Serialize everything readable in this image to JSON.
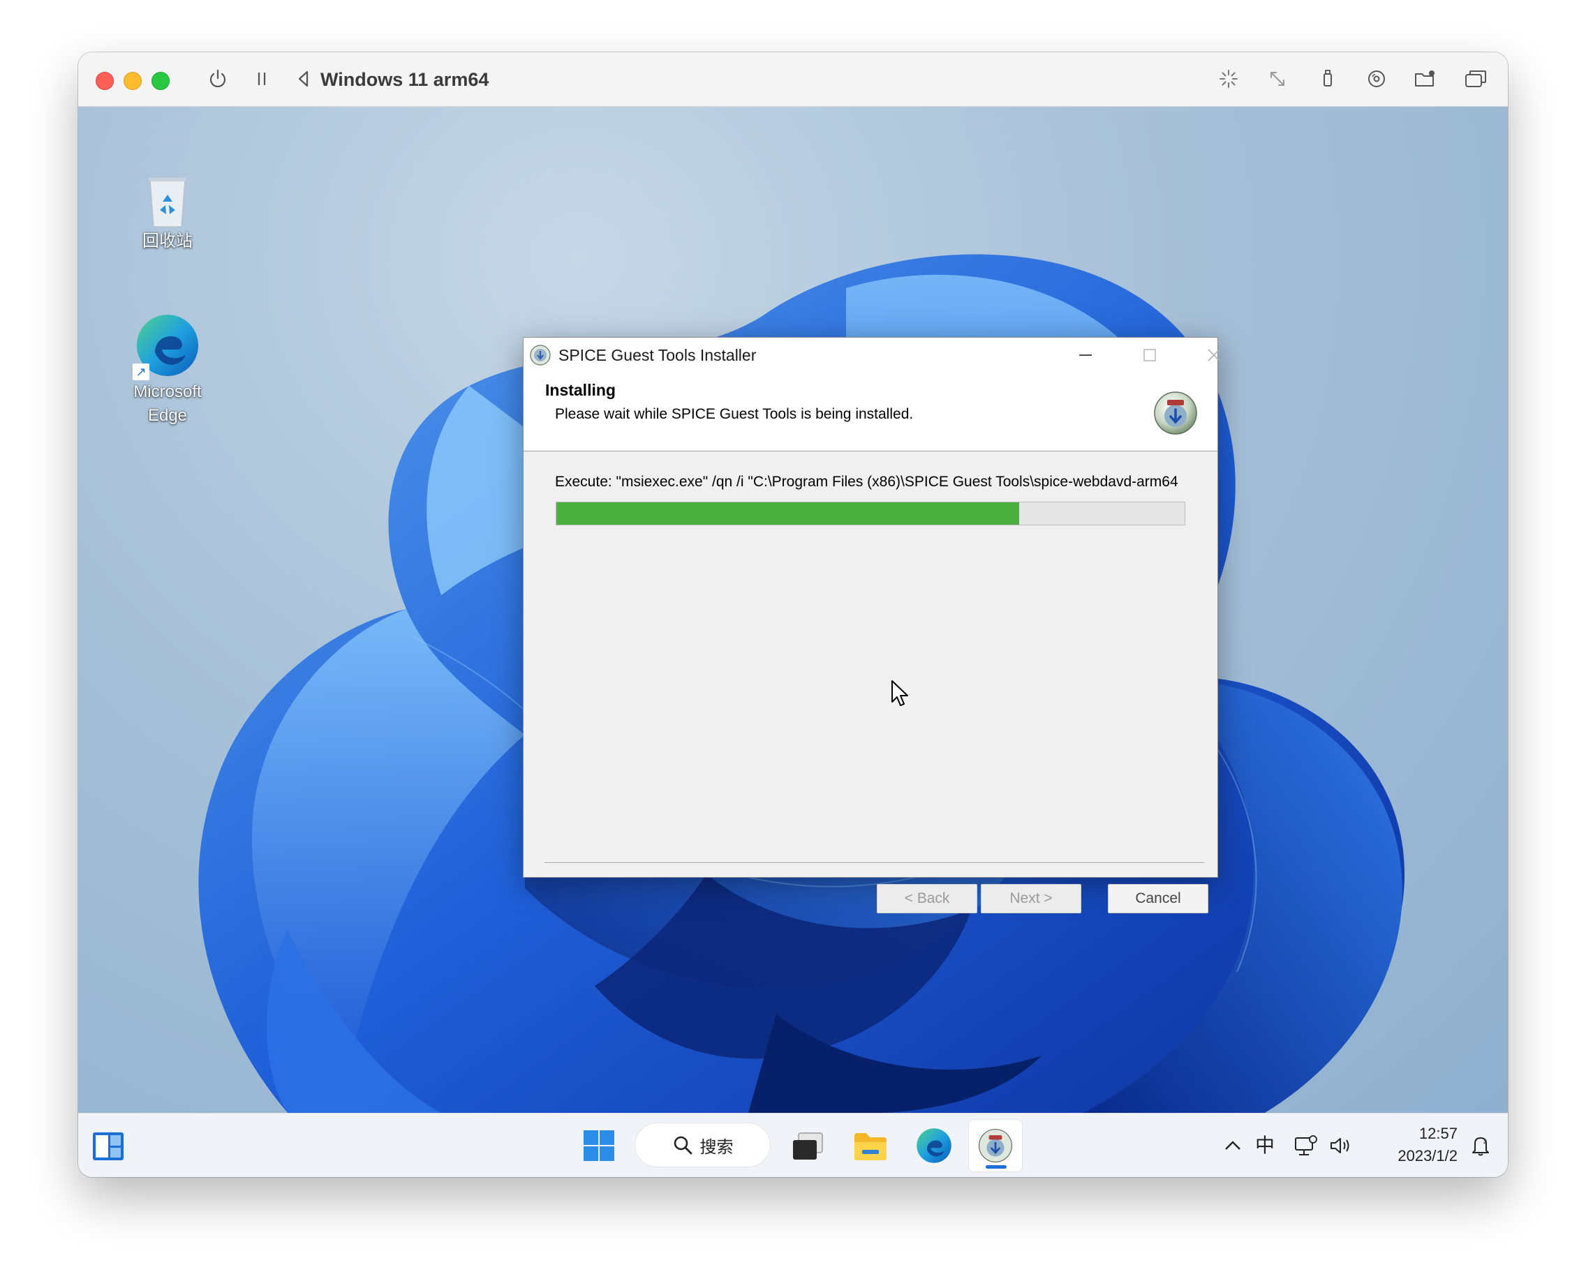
{
  "host": {
    "window_title": "Windows 11 arm64",
    "icons": [
      "power-icon",
      "pause-icon",
      "back-icon",
      "brightness-icon",
      "resize-icon",
      "usb-icon",
      "disc-icon",
      "shared-folder-icon",
      "windows-icon"
    ]
  },
  "desktop": {
    "icons": [
      {
        "label": "回收站",
        "icon": "recycle-bin-icon"
      },
      {
        "label": "Microsoft Edge",
        "icon": "edge-icon"
      }
    ]
  },
  "installer": {
    "title": "SPICE Guest Tools Installer",
    "header_title": "Installing",
    "header_subtitle": "Please wait while SPICE Guest Tools is being installed.",
    "execute_text": "Execute: \"msiexec.exe\" /qn /i \"C:\\Program Files (x86)\\SPICE Guest Tools\\spice-webdavd-arm64",
    "progress": 0.737,
    "buttons": {
      "back": "< Back",
      "next": "Next >",
      "cancel": "Cancel"
    }
  },
  "taskbar": {
    "search_label": "搜索",
    "ime_label": "中",
    "time": "12:57",
    "date": "2023/1/2"
  },
  "colors": {
    "progress_fill": "#4aaf3f",
    "close": "#fe5f57",
    "minimize": "#febc2e",
    "maximize": "#28c840"
  }
}
